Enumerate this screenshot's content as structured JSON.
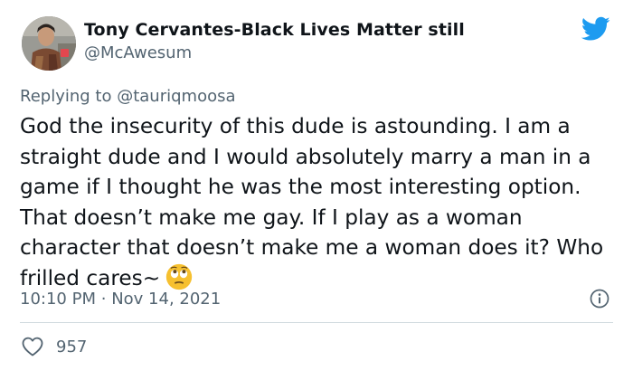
{
  "author": {
    "display_name": "Tony Cervantes-Black Lives Matter still",
    "handle": "@McAwesum",
    "avatar_icon": "profile-photo-icon"
  },
  "brand": {
    "icon": "twitter-bird-icon",
    "color": "#1d9bf0"
  },
  "reply": {
    "prefix": "Replying to",
    "mention": "@tauriqmoosa"
  },
  "tweet": {
    "text": "God the insecurity of this dude is astounding. I am a straight dude and I would absolutely marry a man in a game if I thought he was the most interesting option. That doesn’t make me gay. If I play as a woman character that doesn’t make me a woman does it? Who frilled cares~",
    "emoji": "face-with-rolling-eyes-icon"
  },
  "meta": {
    "time": "10:10 PM",
    "separator": "·",
    "date": "Nov 14, 2021",
    "info_icon": "info-icon"
  },
  "engagement": {
    "like_icon": "heart-icon",
    "likes": "957"
  },
  "colors": {
    "text_primary": "#0f1419",
    "text_secondary": "#536471",
    "divider": "#cfd9de",
    "emoji_face": "#f6c02f"
  }
}
